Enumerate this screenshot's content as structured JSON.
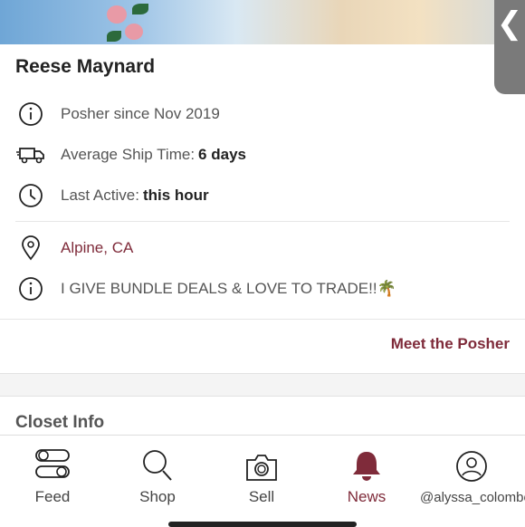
{
  "profile": {
    "name": "Reese Maynard",
    "posher_since": "Posher since Nov 2019",
    "ship_time_label": "Average Ship Time: ",
    "ship_time_value": "6 days",
    "last_active_label": "Last Active: ",
    "last_active_value": "this hour",
    "location": "Alpine, CA",
    "bio": "I GIVE BUNDLE DEALS & LOVE TO TRADE!!🌴",
    "meet_link": "Meet the Posher",
    "section_title": "Closet Info"
  },
  "side_tab": {
    "glyph": "❮"
  },
  "bottom_nav": {
    "items": [
      {
        "label": "Feed",
        "icon": "feed-icon"
      },
      {
        "label": "Shop",
        "icon": "search-icon"
      },
      {
        "label": "Sell",
        "icon": "camera-icon"
      },
      {
        "label": "News",
        "icon": "bell-icon"
      },
      {
        "label": "@alyssa_colombo",
        "icon": "profile-icon"
      }
    ]
  },
  "colors": {
    "accent": "#7f2b3a",
    "text": "#555555"
  }
}
